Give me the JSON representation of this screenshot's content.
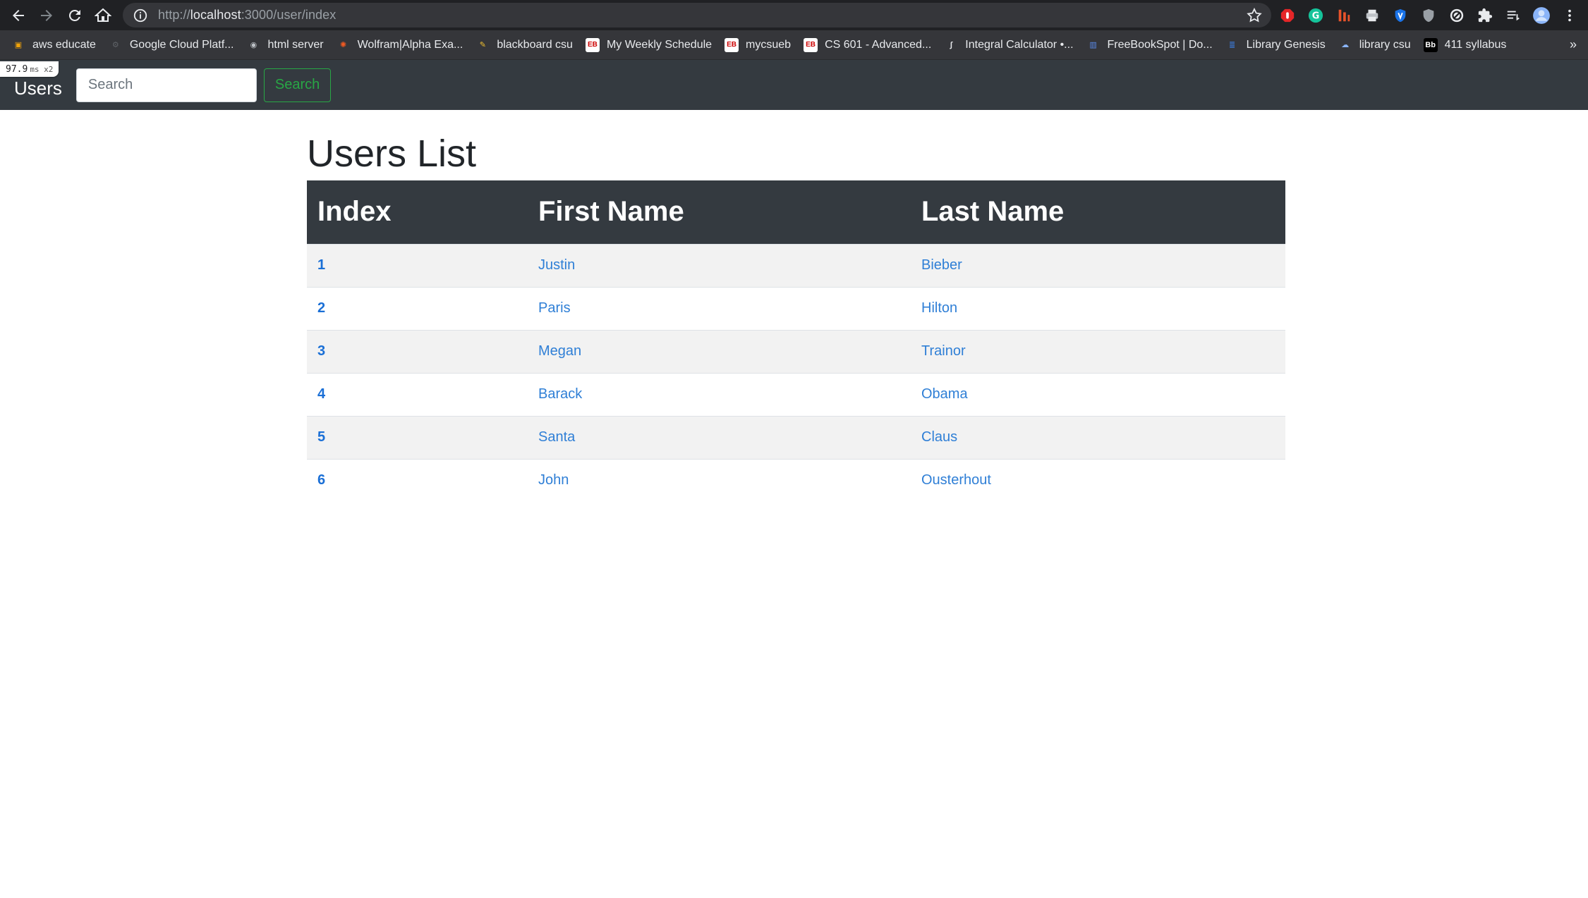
{
  "browser": {
    "url_prefix": "http://",
    "url_host": "localhost",
    "url_rest": ":3000/user/index",
    "bookmarks": [
      {
        "label": "aws educate",
        "color": "#f0a30a",
        "glyph": "▣"
      },
      {
        "label": "Google Cloud Platf...",
        "color": "#5f6368",
        "glyph": "⚙"
      },
      {
        "label": "html server",
        "color": "#bdc1c6",
        "glyph": "◉"
      },
      {
        "label": "Wolfram|Alpha Exa...",
        "color": "#f15a22",
        "glyph": "✺"
      },
      {
        "label": "blackboard csu",
        "color": "#f0c030",
        "glyph": "✎"
      },
      {
        "label": "My Weekly Schedule",
        "color": "#ffffff",
        "glyph": "EB"
      },
      {
        "label": "mycsueb",
        "color": "#ffffff",
        "glyph": "EB"
      },
      {
        "label": "CS 601 - Advanced...",
        "color": "#ffffff",
        "glyph": "EB"
      },
      {
        "label": "Integral Calculator •...",
        "color": "#e8eaed",
        "glyph": "∫"
      },
      {
        "label": "FreeBookSpot | Do...",
        "color": "#5b8def",
        "glyph": "▥"
      },
      {
        "label": "Library Genesis",
        "color": "#3c7bd9",
        "glyph": "≣"
      },
      {
        "label": "library csu",
        "color": "#8ab4f8",
        "glyph": "☁"
      },
      {
        "label": "411 syllabus",
        "color": "#000000",
        "glyph": "Bb"
      }
    ],
    "more_bookmarks": "»",
    "perf_value": "97.9",
    "perf_unit": "ms x2"
  },
  "navbar": {
    "brand": "Users",
    "search_placeholder": "Search",
    "search_button": "Search"
  },
  "page": {
    "title": "Users List",
    "columns": [
      "Index",
      "First Name",
      "Last Name"
    ],
    "rows": [
      {
        "index": "1",
        "first": "Justin",
        "last": "Bieber"
      },
      {
        "index": "2",
        "first": "Paris",
        "last": "Hilton"
      },
      {
        "index": "3",
        "first": "Megan",
        "last": "Trainor"
      },
      {
        "index": "4",
        "first": "Barack",
        "last": "Obama"
      },
      {
        "index": "5",
        "first": "Santa",
        "last": "Claus"
      },
      {
        "index": "6",
        "first": "John",
        "last": "Ousterhout"
      }
    ]
  }
}
